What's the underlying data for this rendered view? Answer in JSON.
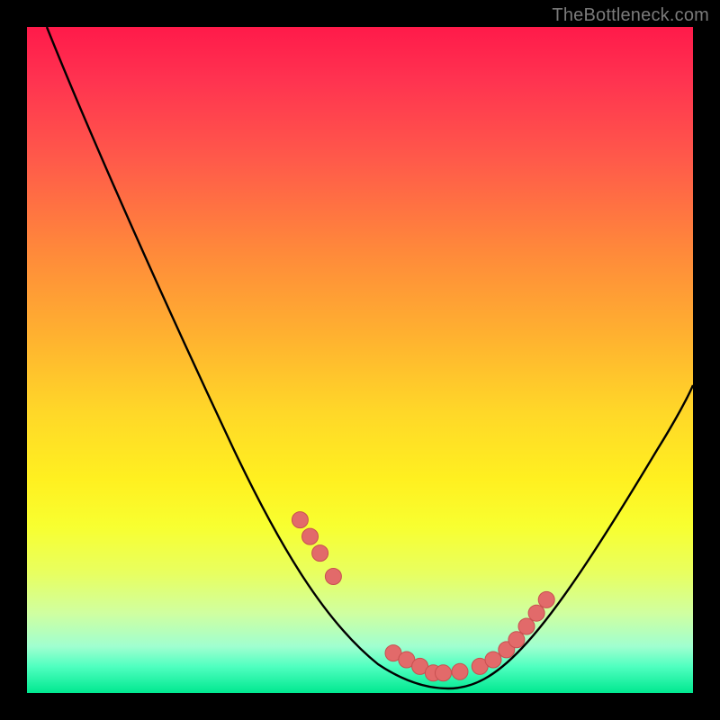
{
  "watermark": "TheBottleneck.com",
  "chart_data": {
    "type": "line",
    "title": "",
    "xlabel": "",
    "ylabel": "",
    "xlim": [
      0,
      100
    ],
    "ylim": [
      0,
      100
    ],
    "grid": false,
    "legend": false,
    "series": [
      {
        "name": "curve",
        "x": [
          3,
          8,
          14,
          20,
          26,
          32,
          38,
          44,
          48,
          52,
          55,
          58,
          61,
          64,
          68,
          72,
          76,
          80,
          85,
          90,
          96,
          100
        ],
        "y": [
          100,
          90,
          78,
          66,
          54,
          42,
          31,
          21,
          14,
          9,
          6,
          4,
          3,
          3,
          4,
          6,
          10,
          16,
          24,
          33,
          44,
          52
        ]
      }
    ],
    "markers": {
      "name": "highlight-points",
      "x": [
        41,
        42.5,
        44,
        46,
        55,
        57,
        59,
        61,
        62.5,
        65,
        68,
        70,
        72,
        73.5,
        75,
        76.5,
        78
      ],
      "y": [
        26,
        23.5,
        21,
        17.5,
        6,
        5,
        4,
        3,
        3,
        3.2,
        4,
        5,
        6.5,
        8,
        10,
        12,
        14
      ]
    },
    "colors": {
      "curve": "#000000",
      "marker_fill": "#e26a6a",
      "marker_stroke": "#c85050"
    }
  }
}
